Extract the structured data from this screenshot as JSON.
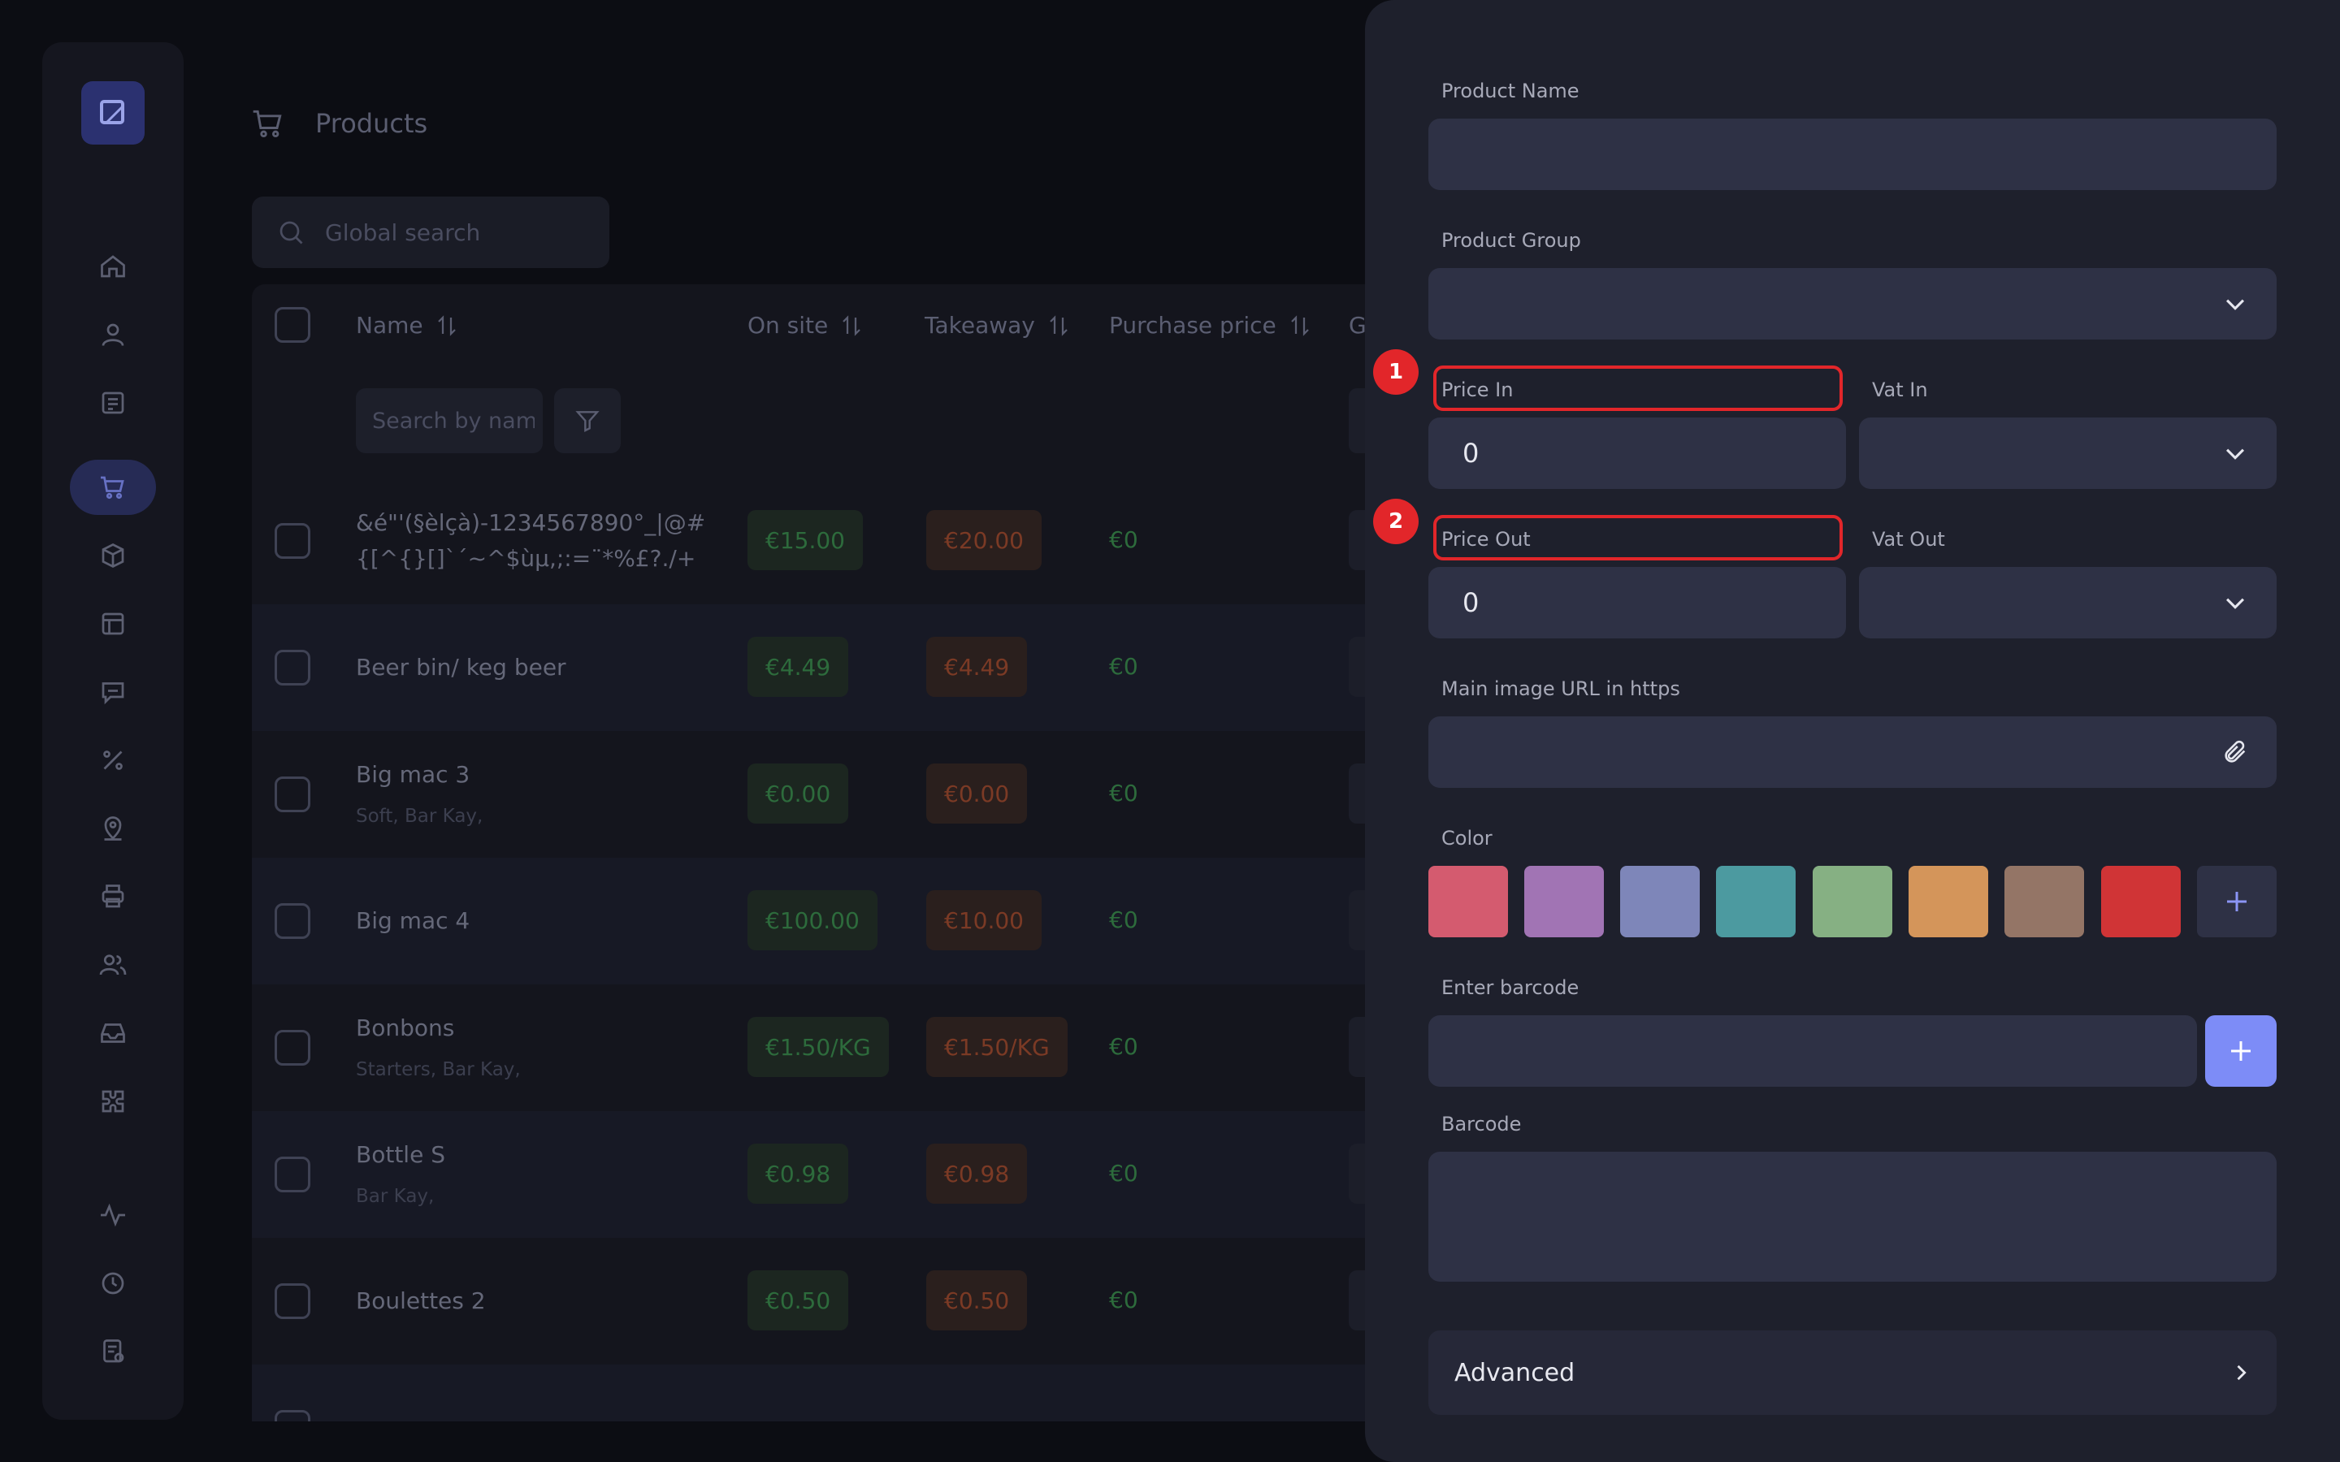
{
  "page": {
    "title": "Products"
  },
  "sidebar": {
    "items": [
      {
        "icon": "home-icon"
      },
      {
        "icon": "user-icon"
      },
      {
        "icon": "receipt-icon"
      },
      {
        "icon": "cart-icon",
        "active": true
      },
      {
        "icon": "box-icon"
      },
      {
        "icon": "table-icon"
      },
      {
        "icon": "chat-icon"
      },
      {
        "icon": "percent-icon"
      },
      {
        "icon": "location-icon"
      },
      {
        "icon": "printer-icon"
      },
      {
        "icon": "users-icon"
      },
      {
        "icon": "inbox-icon"
      },
      {
        "icon": "puzzle-icon"
      },
      {
        "icon": "activity-icon"
      },
      {
        "icon": "clock-icon"
      },
      {
        "icon": "report-icon"
      }
    ]
  },
  "search": {
    "placeholder": "Global search",
    "name_placeholder": "Search by name"
  },
  "table": {
    "columns": [
      "Name",
      "On site",
      "Takeaway",
      "Purchase price",
      "G"
    ],
    "rows": [
      {
        "name": "&é\"'(§èlçà)-1234567890°_|@#{[^{}[]`´~^$ùµ,;:=¨*%£?./+",
        "sub": "",
        "on_site": "€15.00",
        "takeaway": "€20.00",
        "purchase": "€0"
      },
      {
        "name": "Beer bin/ keg beer",
        "sub": "",
        "on_site": "€4.49",
        "takeaway": "€4.49",
        "purchase": "€0"
      },
      {
        "name": "Big mac 3",
        "sub": "Soft, Bar Kay,",
        "on_site": "€0.00",
        "takeaway": "€0.00",
        "purchase": "€0"
      },
      {
        "name": "Big mac 4",
        "sub": "",
        "on_site": "€100.00",
        "takeaway": "€10.00",
        "purchase": "€0"
      },
      {
        "name": "Bonbons",
        "sub": "Starters, Bar Kay,",
        "on_site": "€1.50/KG",
        "takeaway": "€1.50/KG",
        "purchase": "€0"
      },
      {
        "name": "Bottle S",
        "sub": "Bar Kay,",
        "on_site": "€0.98",
        "takeaway": "€0.98",
        "purchase": "€0"
      },
      {
        "name": "Boulettes 2",
        "sub": "",
        "on_site": "€0.50",
        "takeaway": "€0.50",
        "purchase": "€0"
      }
    ]
  },
  "form": {
    "product_name": {
      "label": "Product Name",
      "value": ""
    },
    "product_group": {
      "label": "Product Group",
      "value": ""
    },
    "price_in": {
      "label": "Price In",
      "value": "0",
      "badge": "1"
    },
    "vat_in": {
      "label": "Vat In",
      "value": ""
    },
    "price_out": {
      "label": "Price Out",
      "value": "0",
      "badge": "2"
    },
    "vat_out": {
      "label": "Vat Out",
      "value": ""
    },
    "image_url": {
      "label": "Main image URL in https",
      "value": ""
    },
    "color": {
      "label": "Color",
      "swatches": [
        "#d45b6f",
        "#a174b4",
        "#7e86b9",
        "#4c9aa0",
        "#86b083",
        "#d4955a",
        "#947566",
        "#d03436"
      ]
    },
    "barcode_input": {
      "label": "Enter barcode",
      "value": ""
    },
    "barcode": {
      "label": "Barcode",
      "value": ""
    },
    "advanced": {
      "label": "Advanced"
    }
  }
}
